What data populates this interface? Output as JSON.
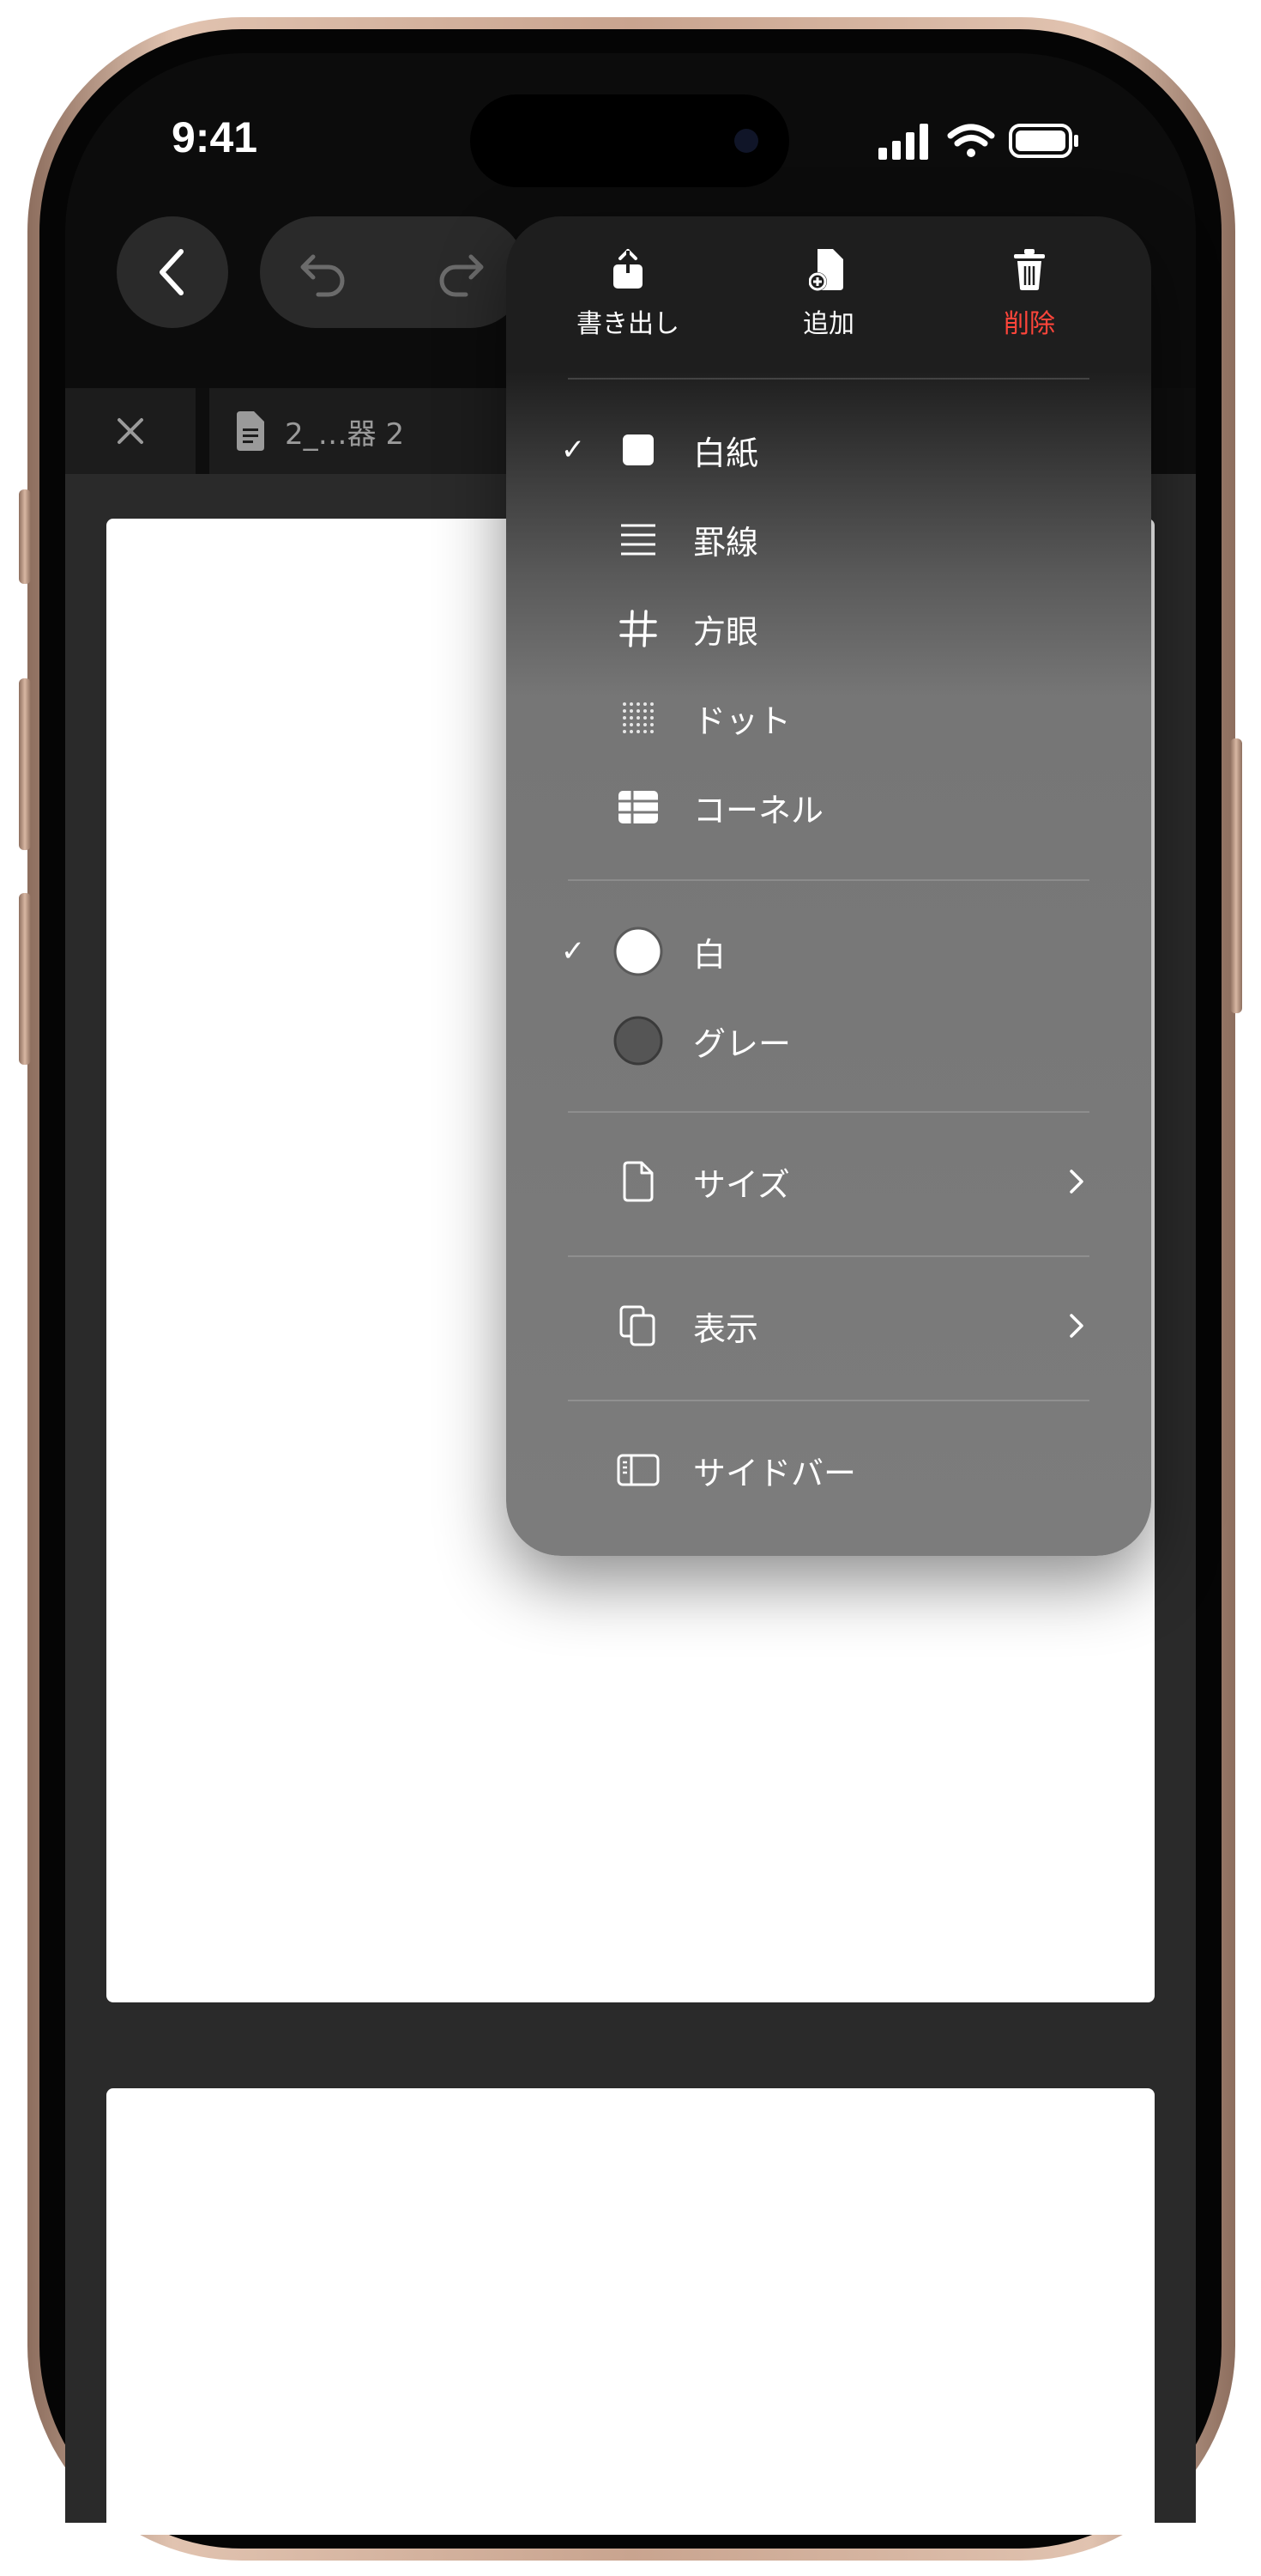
{
  "status_bar": {
    "time": "9:41",
    "icons": [
      "cellular-signal-icon",
      "wifi-icon",
      "battery-icon"
    ]
  },
  "toolbar": {
    "back_icon": "chevron-left-icon",
    "undo_icon": "undo-icon",
    "redo_icon": "redo-icon"
  },
  "tabs": {
    "close_icon": "close-icon",
    "doc_title": "2_…器 2"
  },
  "menu": {
    "actions": [
      {
        "label": "書き出し",
        "icon": "share-icon"
      },
      {
        "label": "追加",
        "icon": "add-page-icon"
      },
      {
        "label": "削除",
        "icon": "trash-icon",
        "color": "#ff453a"
      }
    ],
    "templates": [
      {
        "label": "白紙",
        "icon": "blank-square-icon",
        "checked": true
      },
      {
        "label": "罫線",
        "icon": "lines-icon",
        "checked": false
      },
      {
        "label": "方眼",
        "icon": "grid-icon",
        "checked": false
      },
      {
        "label": "ドット",
        "icon": "dots-icon",
        "checked": false
      },
      {
        "label": "コーネル",
        "icon": "cornell-icon",
        "checked": false
      }
    ],
    "colors": [
      {
        "label": "白",
        "swatch": "#ffffff",
        "checked": true
      },
      {
        "label": "グレー",
        "swatch": "#555555",
        "checked": false
      }
    ],
    "size": {
      "label": "サイズ",
      "icon": "page-icon"
    },
    "view": {
      "label": "表示",
      "icon": "copy-pages-icon"
    },
    "sidebar": {
      "label": "サイドバー",
      "icon": "sidebar-icon"
    },
    "check_mark": "✓"
  }
}
